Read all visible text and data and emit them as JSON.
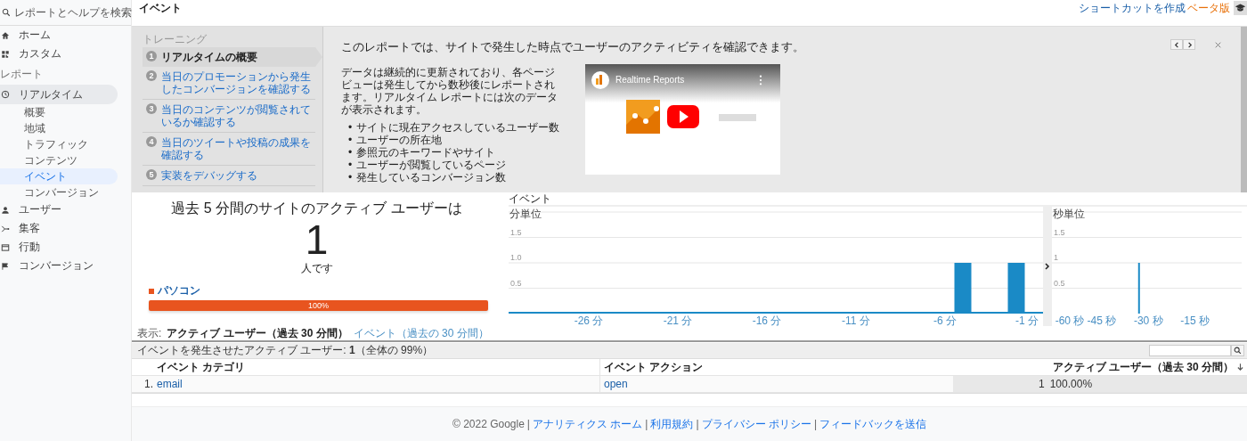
{
  "sidebar": {
    "search": {
      "placeholder": "レポートとヘルプを検索"
    },
    "items": [
      {
        "label": "ホーム",
        "selected": false
      },
      {
        "label": "カスタム",
        "selected": false
      }
    ],
    "section_label": "レポート",
    "reports": [
      {
        "label": "リアルタイム",
        "selected": true,
        "children": [
          {
            "label": "概要",
            "selected": false
          },
          {
            "label": "地域",
            "selected": false
          },
          {
            "label": "トラフィック",
            "selected": false
          },
          {
            "label": "コンテンツ",
            "selected": false
          },
          {
            "label": "イベント",
            "selected": true
          },
          {
            "label": "コンバージョン",
            "selected": false
          }
        ]
      },
      {
        "label": "ユーザー",
        "selected": false
      },
      {
        "label": "集客",
        "selected": false
      },
      {
        "label": "行動",
        "selected": false
      },
      {
        "label": "コンバージョン",
        "selected": false
      }
    ]
  },
  "header": {
    "title": "イベント",
    "shortcut_link": "ショートカットを作成",
    "beta_badge": "ベータ版"
  },
  "training": {
    "label": "トレーニング",
    "steps": [
      {
        "number": "1",
        "label": "リアルタイムの概要",
        "selected": true
      },
      {
        "number": "2",
        "label": "当日のプロモーションから発生したコンバージョンを確認する",
        "selected": false
      },
      {
        "number": "3",
        "label": "当日のコンテンツが閲覧されているか確認する",
        "selected": false
      },
      {
        "number": "4",
        "label": "当日のツイートや投稿の成果を確認する",
        "selected": false
      },
      {
        "number": "5",
        "label": "実装をデバッグする",
        "selected": false
      }
    ],
    "heading": "このレポートでは、サイトで発生した時点でユーザーのアクティビティを確認できます。",
    "description": "データは継続的に更新されており、各ページビューは発生してから数秒後にレポートされます。リアルタイム レポートには次のデータが表示されます。",
    "bullet_marker": "•",
    "bullets": [
      "サイトに現在アクセスしているユーザー数",
      "ユーザーの所在地",
      "参照元のキーワードやサイト",
      "ユーザーが閲覧しているページ",
      "発生しているコンバージョン数"
    ],
    "video": {
      "title": "Realtime Reports"
    }
  },
  "summary": {
    "headline": "過去 5 分間のサイトのアクティブ ユーザーは",
    "count": "1",
    "unit": "人です",
    "devices": [
      {
        "label": "パソコン",
        "color": "#e8541f",
        "level": 1,
        "percent": "100%"
      }
    ]
  },
  "events_chart": {
    "title": "イベント",
    "panels": [
      {
        "label": "分単位",
        "chart_data": {
          "type": "bar",
          "grid": true,
          "x": [
            -30,
            -29,
            -28,
            -27,
            -26,
            -25,
            -24,
            -23,
            -22,
            -21,
            -20,
            -19,
            -18,
            -17,
            -16,
            -15,
            -14,
            -13,
            -12,
            -11,
            -10,
            -9,
            -8,
            -7,
            -6,
            -5,
            -4,
            -3,
            -2,
            -1
          ],
          "series": [
            {
              "color": "#1a8ac6",
              "values": [
                0,
                0,
                0,
                0,
                0,
                0,
                0,
                0,
                0,
                0,
                0,
                0,
                0,
                0,
                0,
                0,
                0,
                0,
                0,
                0,
                0,
                0,
                0,
                0,
                0,
                1,
                0,
                0,
                1,
                0
              ]
            }
          ],
          "xlim": [
            -30.5,
            -0.5
          ],
          "ylim": [
            0,
            2
          ],
          "yticks": [
            {
              "value": 0.5,
              "label": "0.5"
            },
            {
              "value": 1,
              "label": "1.0"
            },
            {
              "value": 1.5,
              "label": "1.5"
            }
          ],
          "xticks": [
            {
              "value": -26,
              "label": "-26 分"
            },
            {
              "value": -21,
              "label": "-21 分"
            },
            {
              "value": -16,
              "label": "-16 分"
            },
            {
              "value": -11,
              "label": "-11 分"
            },
            {
              "value": -6,
              "label": "-6 分"
            },
            {
              "value": -1,
              "label": "-1 分"
            }
          ]
        }
      },
      {
        "label": "秒単位",
        "chart_data": {
          "type": "bar",
          "grid": true,
          "x": [
            -60,
            -59,
            -58,
            -57,
            -56,
            -55,
            -54,
            -53,
            -52,
            -51,
            -50,
            -49,
            -48,
            -47,
            -46,
            -45,
            -44,
            -43,
            -42,
            -41,
            -40,
            -39,
            -38,
            -37,
            -36,
            -35,
            -34,
            -33,
            -32,
            -31,
            -30,
            -29,
            -28,
            -27,
            -26,
            -25,
            -24,
            -23,
            -22,
            -21,
            -20,
            -19,
            -18,
            -17,
            -16,
            -15,
            -14,
            -13,
            -12,
            -11,
            -10,
            -9,
            -8,
            -7,
            -6,
            -5,
            -4,
            -3,
            -2,
            -1
          ],
          "series": [
            {
              "color": "#1a8ac6",
              "values": [
                0,
                0,
                0,
                0,
                0,
                0,
                0,
                0,
                0,
                0,
                0,
                0,
                0,
                0,
                0,
                0,
                0,
                0,
                0,
                0,
                0,
                0,
                0,
                0,
                0,
                0,
                0,
                1,
                0,
                0,
                0,
                0,
                0,
                0,
                0,
                0,
                0,
                0,
                0,
                0,
                0,
                0,
                0,
                0,
                0,
                0,
                0,
                0,
                0,
                0,
                0,
                0,
                0,
                0,
                0,
                0,
                0,
                0,
                0,
                0
              ]
            }
          ],
          "xlim": [
            -61,
            0
          ],
          "ylim": [
            0,
            2
          ],
          "yticks": [
            {
              "value": 0.5,
              "label": "0.5"
            },
            {
              "value": 1,
              "label": "1"
            },
            {
              "value": 1.5,
              "label": "1.5"
            }
          ],
          "xticks": [
            {
              "value": -60,
              "label": "-60 秒"
            },
            {
              "value": -45,
              "label": "-45 秒"
            },
            {
              "value": -30,
              "label": "-30 秒"
            },
            {
              "value": -15,
              "label": "-15 秒"
            }
          ]
        }
      }
    ]
  },
  "view_tabs": {
    "label": "表示:",
    "tabs": [
      {
        "label": "アクティブ ユーザー（過去 30 分間）",
        "selected": true
      },
      {
        "label": "イベント（過去の 30 分間）",
        "selected": false
      }
    ]
  },
  "table": {
    "summary": "イベントを発生させたアクティブ ユーザー: **1**（全体の 99%）",
    "columns": [
      "イベント カテゴリ",
      "イベント アクション",
      "アクティブ ユーザー（過去 30 分間）"
    ],
    "rows": [
      {
        "index": "1.",
        "category": "email",
        "action": "open",
        "users": "1",
        "share": "100.00%"
      }
    ]
  },
  "footer": {
    "copyright": "© 2022 Google",
    "separator": "|",
    "links": [
      "アナリティクス ホーム",
      "利用規約",
      "プライバシー ポリシー",
      "フィードバックを送信"
    ]
  }
}
